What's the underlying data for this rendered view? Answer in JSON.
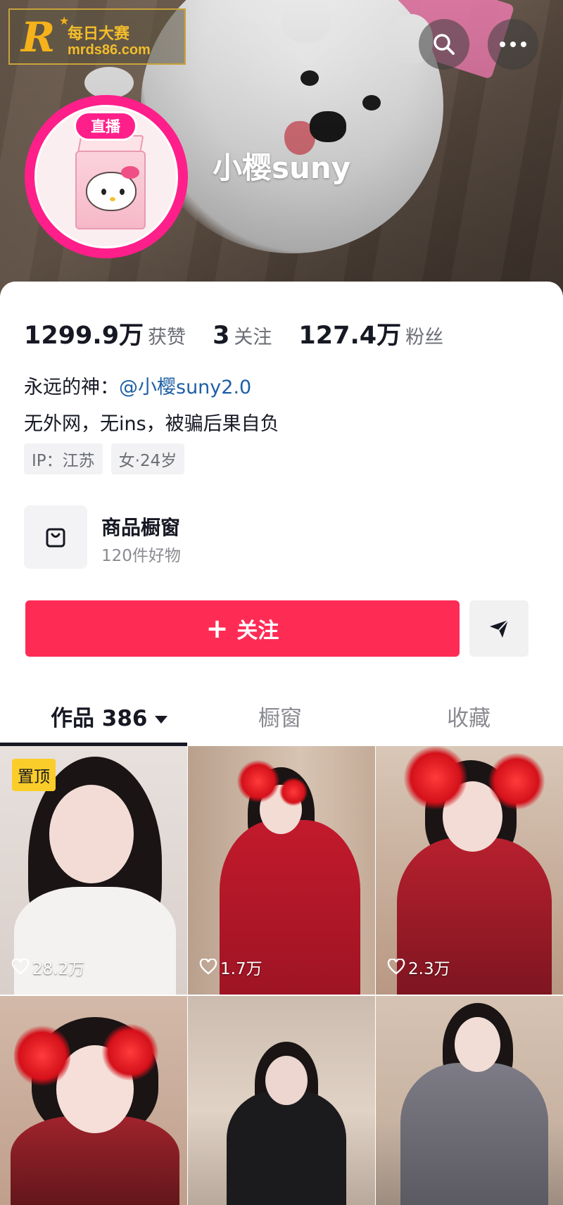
{
  "watermark": {
    "line1": "每日大赛",
    "line2": "mrds86.com",
    "logo_letter": "R"
  },
  "header": {
    "live_badge": "直播",
    "username": "小樱suny",
    "search_icon": "search-icon",
    "more_icon": "more-icon"
  },
  "stats": {
    "likes_value": "1299.9万",
    "likes_label": "获赞",
    "following_value": "3",
    "following_label": "关注",
    "followers_value": "127.4万",
    "followers_label": "粉丝"
  },
  "bio": {
    "line1_prefix": "永远的神：",
    "line1_mention": "@小樱suny2.0",
    "line2": "无外网，无ins，被骗后果自负",
    "tags": [
      "IP：江苏",
      "女·24岁"
    ]
  },
  "shop": {
    "title": "商品橱窗",
    "subtitle": "120件好物",
    "icon": "shopping-bag-icon"
  },
  "actions": {
    "follow_label": "关注",
    "share_icon": "send-icon"
  },
  "tabs": {
    "works": "作品 386",
    "window": "橱窗",
    "favorites": "收藏"
  },
  "grid": {
    "pinned_label": "置顶",
    "items": [
      {
        "likes": "28.2万"
      },
      {
        "likes": "1.7万"
      },
      {
        "likes": "2.3万"
      },
      {
        "likes": ""
      },
      {
        "likes": ""
      },
      {
        "likes": ""
      }
    ]
  },
  "colors": {
    "accent": "#fe2c55",
    "avatar_ring": "#ff1f8a",
    "pin": "#fbcd2a",
    "mention": "#1d5fa5"
  }
}
